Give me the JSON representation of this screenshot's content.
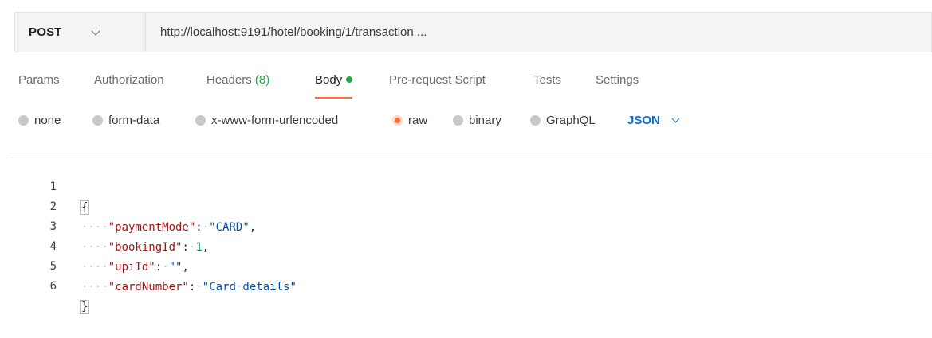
{
  "request": {
    "method": "POST",
    "url": "http://localhost:9191/hotel/booking/1/transaction ..."
  },
  "tabs": [
    {
      "label": "Params"
    },
    {
      "label": "Authorization"
    },
    {
      "label": "Headers",
      "count": "(8)"
    },
    {
      "label": "Body",
      "active": true
    },
    {
      "label": "Pre-request Script"
    },
    {
      "label": "Tests"
    },
    {
      "label": "Settings"
    }
  ],
  "body_types": {
    "options": [
      "none",
      "form-data",
      "x-www-form-urlencoded",
      "raw",
      "binary",
      "GraphQL"
    ],
    "selected": "raw",
    "language": "JSON"
  },
  "editor": {
    "line_numbers": [
      "1",
      "2",
      "3",
      "4",
      "5",
      "6"
    ],
    "open_brace": "{",
    "close_brace": "}",
    "fields": [
      {
        "key": "\"paymentMode\"",
        "value": "\"CARD\"",
        "trailing": ","
      },
      {
        "key": "\"bookingId\"",
        "value": "1",
        "trailing": ","
      },
      {
        "key": "\"upiId\"",
        "value": "\"\"",
        "trailing": ","
      },
      {
        "key": "\"cardNumber\"",
        "value": "\"Card·details\"",
        "trailing": ""
      }
    ],
    "indent": "····",
    "colon": ":·"
  },
  "colors": {
    "accent": "#ff6c37",
    "json_label": "#0c6dd0",
    "success": "#28a745"
  }
}
